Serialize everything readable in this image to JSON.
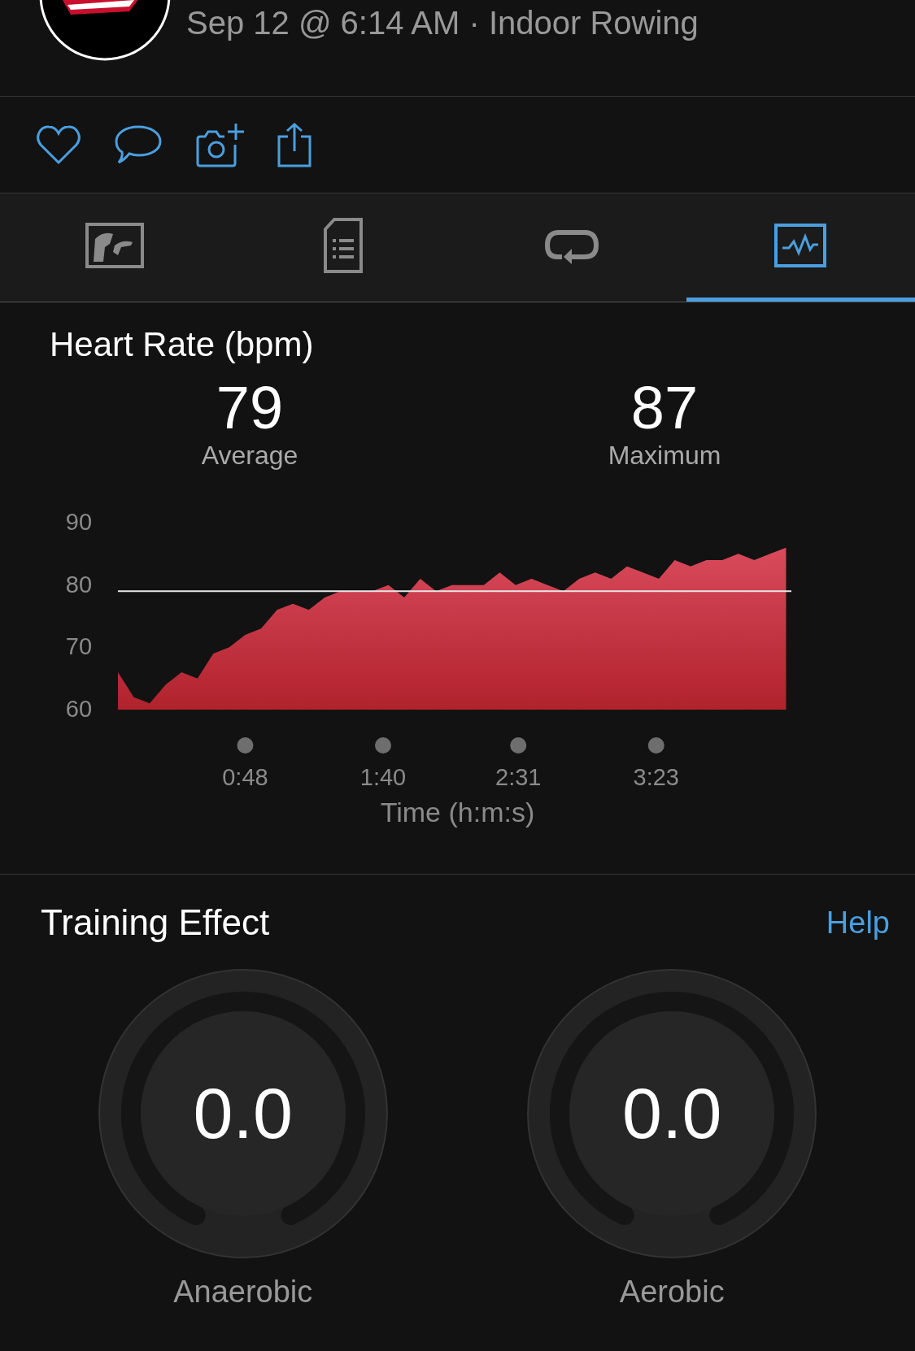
{
  "header": {
    "subtitle": "Sep 12 @ 6:14 AM · Indoor Rowing"
  },
  "tabs": [
    {
      "kind": "map",
      "selected": false
    },
    {
      "kind": "details",
      "selected": false
    },
    {
      "kind": "laps",
      "selected": false
    },
    {
      "kind": "charts",
      "selected": true
    }
  ],
  "heart_rate": {
    "title": "Heart Rate (bpm)",
    "stats": [
      {
        "value": "79",
        "label": "Average"
      },
      {
        "value": "87",
        "label": "Maximum"
      }
    ],
    "chart_data": {
      "type": "area",
      "xlabel": "Time (h:m:s)",
      "x": [
        0,
        6,
        12,
        18,
        24,
        30,
        36,
        42,
        48,
        54,
        60,
        66,
        72,
        78,
        84,
        90,
        96,
        102,
        108,
        114,
        120,
        126,
        132,
        138,
        144,
        150,
        156,
        162,
        168,
        174,
        180,
        186,
        192,
        198,
        204,
        210,
        216,
        222,
        228,
        234,
        240,
        246,
        252
      ],
      "series": [
        {
          "color": "#d94a5c",
          "values": [
            66,
            62,
            61,
            64,
            66,
            65,
            69,
            70,
            72,
            73,
            76,
            77,
            76,
            78,
            79,
            79,
            79,
            80,
            78,
            81,
            79,
            80,
            80,
            80,
            82,
            80,
            81,
            80,
            79,
            81,
            82,
            81,
            83,
            82,
            81,
            84,
            83,
            84,
            84,
            85,
            84,
            85,
            86
          ]
        }
      ],
      "xlim": [
        0,
        254
      ],
      "ylim": [
        60,
        90
      ],
      "xticks": [
        {
          "value": 48,
          "label": "0:48"
        },
        {
          "value": 100,
          "label": "1:40"
        },
        {
          "value": 151,
          "label": "2:31"
        },
        {
          "value": 203,
          "label": "3:23"
        }
      ],
      "yticks": [
        60,
        70,
        80,
        90
      ],
      "ref_lines": [
        {
          "axis": "y",
          "value": 79
        }
      ]
    }
  },
  "training_effect": {
    "title": "Training Effect",
    "help": "Help",
    "gauges": [
      {
        "value": "0.0",
        "label": "Anaerobic"
      },
      {
        "value": "0.0",
        "label": "Aerobic"
      }
    ]
  }
}
